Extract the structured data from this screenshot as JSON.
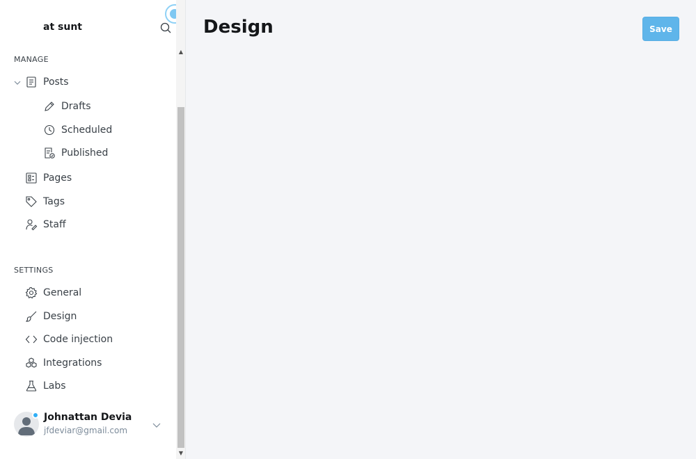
{
  "sidebar": {
    "site_title": "at sunt",
    "manage_heading": "MANAGE",
    "settings_heading": "SETTINGS",
    "manage_items": [
      {
        "label": "Posts",
        "icon": "posts-icon"
      },
      {
        "label": "Drafts",
        "icon": "pencil-icon"
      },
      {
        "label": "Scheduled",
        "icon": "clock-icon"
      },
      {
        "label": "Published",
        "icon": "published-icon"
      },
      {
        "label": "Pages",
        "icon": "pages-icon"
      },
      {
        "label": "Tags",
        "icon": "tag-icon"
      },
      {
        "label": "Staff",
        "icon": "staff-icon"
      }
    ],
    "settings_items": [
      {
        "label": "General",
        "icon": "gear-icon"
      },
      {
        "label": "Design",
        "icon": "brush-icon"
      },
      {
        "label": "Code injection",
        "icon": "code-icon"
      },
      {
        "label": "Integrations",
        "icon": "integrations-icon"
      },
      {
        "label": "Labs",
        "icon": "flask-icon"
      }
    ],
    "user": {
      "name": "Johnattan Devia",
      "email": "jfdeviar@gmail.com"
    }
  },
  "main": {
    "title": "Design",
    "save_label": "Save"
  },
  "colors": {
    "accent": "#5fb5ea",
    "status": "#30aef5",
    "background": "#f4f5f8"
  }
}
